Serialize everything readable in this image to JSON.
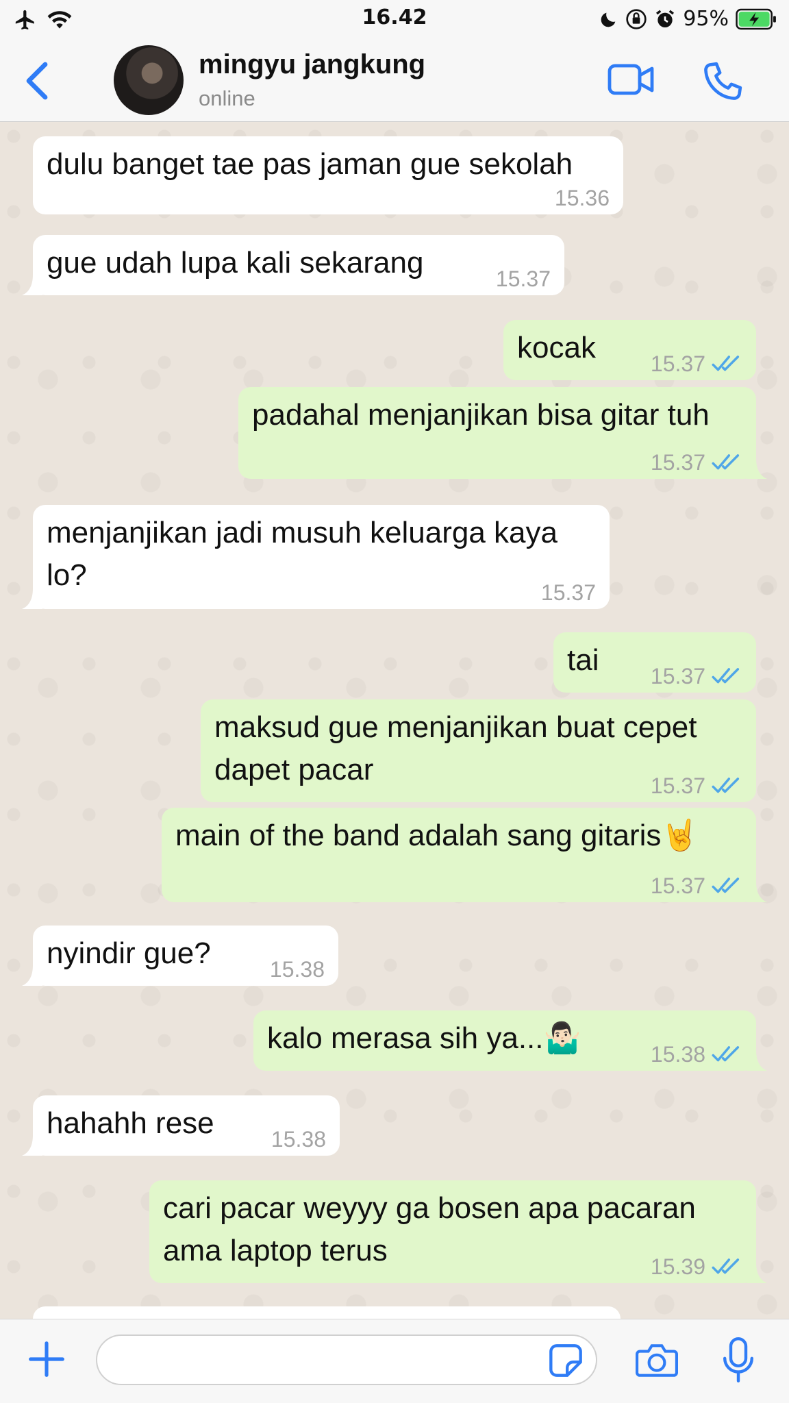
{
  "status_bar": {
    "time": "16.42",
    "battery": "95%",
    "icons": [
      "airplane-icon",
      "wifi-icon",
      "moon-icon",
      "orientation-lock-icon",
      "alarm-icon",
      "battery-charging-icon"
    ]
  },
  "header": {
    "contact_name": "mingyu jangkung",
    "contact_status": "online",
    "icons": [
      "back-chevron-icon",
      "video-call-icon",
      "phone-call-icon"
    ]
  },
  "messages": [
    {
      "dir": "in",
      "text": "dulu banget tae pas jaman gue sekolah",
      "time": "15.36"
    },
    {
      "dir": "in",
      "text": "gue udah lupa kali sekarang",
      "time": "15.37"
    },
    {
      "dir": "out",
      "text": "kocak",
      "time": "15.37",
      "read": true
    },
    {
      "dir": "out",
      "text": "padahal menjanjikan bisa gitar tuh",
      "time": "15.37",
      "read": true
    },
    {
      "dir": "in",
      "text": "menjanjikan jadi musuh keluarga kaya\nlo?",
      "time": "15.37"
    },
    {
      "dir": "out",
      "text": "tai",
      "time": "15.37",
      "read": true
    },
    {
      "dir": "out",
      "text": "maksud gue menjanjikan buat cepet\ndapet pacar",
      "time": "15.37",
      "read": true
    },
    {
      "dir": "out",
      "text": "main of the band adalah sang gitaris🤘",
      "time": "15.37",
      "read": true
    },
    {
      "dir": "in",
      "text": "nyindir gue?",
      "time": "15.38"
    },
    {
      "dir": "out",
      "text": "kalo merasa sih ya...🤷🏻‍♂️",
      "time": "15.38",
      "read": true
    },
    {
      "dir": "in",
      "text": "hahahh rese",
      "time": "15.38"
    },
    {
      "dir": "out",
      "text": "cari pacar weyyy ga bosen apa pacaran\nama laptop terus",
      "time": "15.39",
      "read": true
    }
  ],
  "input_bar": {
    "placeholder": "",
    "icons": [
      "plus-icon",
      "sticker-icon",
      "camera-icon",
      "microphone-icon"
    ]
  },
  "colors": {
    "accent": "#2f7cf6",
    "outgoing_bubble": "#e1f7cb",
    "incoming_bubble": "#ffffff",
    "read_tick": "#4fa6e8",
    "chat_background": "#ebe4dc"
  }
}
